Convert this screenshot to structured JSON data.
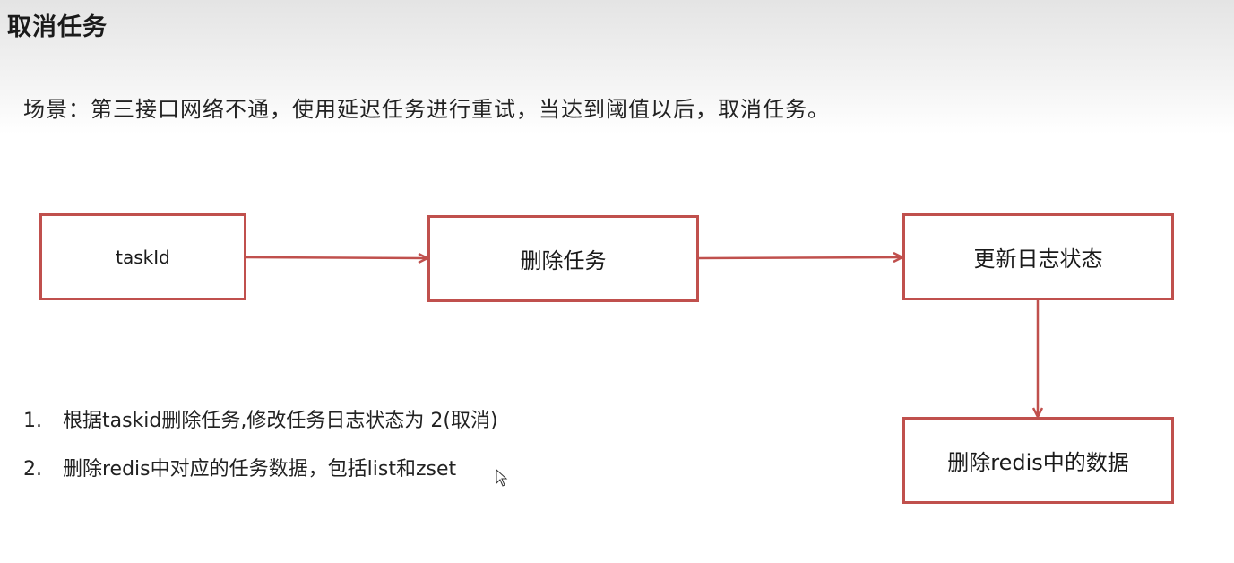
{
  "title": "取消任务",
  "scenario": "场景：第三接口网络不通，使用延迟任务进行重试，当达到阈值以后，取消任务。",
  "flow": {
    "box1": "taskId",
    "box2": "删除任务",
    "box3": "更新日志状态",
    "box4": "删除redis中的数据"
  },
  "steps": [
    {
      "num": "1.",
      "text": "根据taskid删除任务,修改任务日志状态为 2(取消)"
    },
    {
      "num": "2.",
      "text": "删除redis中对应的任务数据，包括list和zset"
    }
  ],
  "colors": {
    "accent": "#c0504d"
  },
  "icons": {
    "cursor": "mouse-pointer-icon"
  }
}
